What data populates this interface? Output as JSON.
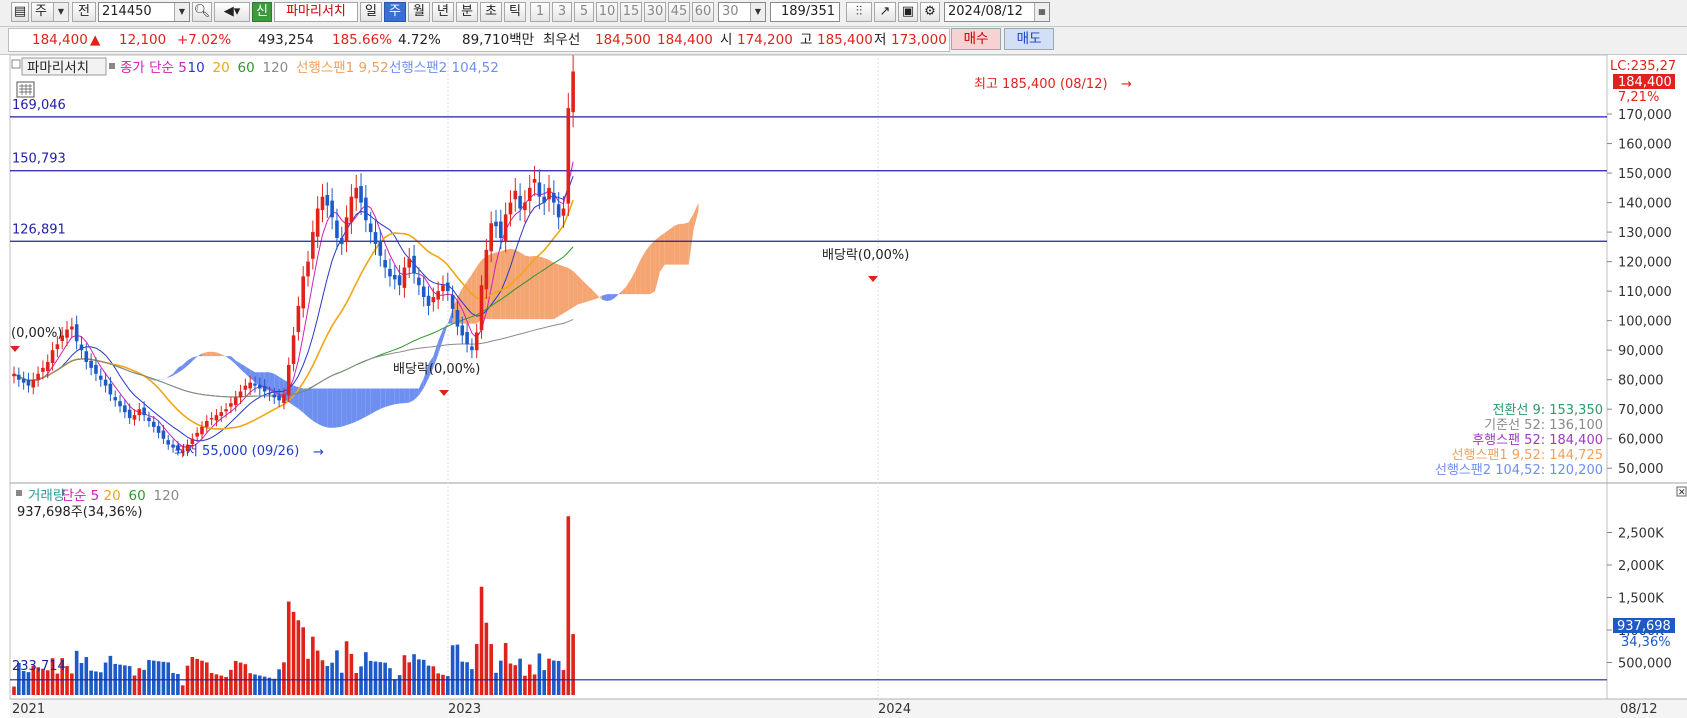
{
  "toolbar": {
    "period_label": "주",
    "prev_label": "전",
    "stock_code": "214450",
    "new_badge": "신",
    "stock_name": "파마리서치",
    "intervals": [
      "일",
      "주",
      "월",
      "년",
      "분",
      "초",
      "틱"
    ],
    "selected_interval": "주",
    "counts": [
      "1",
      "3",
      "5",
      "10",
      "15",
      "30",
      "45",
      "60"
    ],
    "count_value": "30",
    "range_value": "189/351",
    "date_value": "2024/08/12"
  },
  "quote": {
    "price": "184,400",
    "arrow": "▲",
    "change": "12,100",
    "change_pct": "+7.02%",
    "volume": "493,254",
    "volume_ratio": "185.66%",
    "turnover": "4.72%",
    "amount": "89,710백만",
    "best_label": "최우선",
    "ask": "184,500",
    "bid": "184,400",
    "open_label": "시",
    "open": "174,200",
    "high_label": "고",
    "high": "185,400",
    "low_label": "저",
    "low": "173,000",
    "buy_label": "매수",
    "sell_label": "매도"
  },
  "colors": {
    "up": "#e0221b",
    "down": "#1c5ac8",
    "ma5": "#d21fb8",
    "ma10": "#2838c8",
    "ma20": "#f2a516",
    "ma60": "#2c9a2c",
    "ma120": "#8a8a8a",
    "cloud_up": "#f5a572",
    "cloud_down": "#6f8ff0",
    "hline": "#1f1fa8"
  },
  "price_panel": {
    "title": "파마리서치",
    "legend": [
      {
        "text": "종가 단순 5",
        "color": "#d21fb8"
      },
      {
        "text": "10",
        "color": "#2838c8"
      },
      {
        "text": "20",
        "color": "#f2a516"
      },
      {
        "text": "60",
        "color": "#2c9a2c"
      },
      {
        "text": "120",
        "color": "#8a8a8a"
      },
      {
        "text": "선행스팬1 9,52",
        "color": "#f2a05a"
      },
      {
        "text": "선행스팬2 104,52",
        "color": "#6f8ff0"
      }
    ],
    "hlines": [
      {
        "label": "169,046",
        "value": 169046
      },
      {
        "label": "150,793",
        "value": 150793
      },
      {
        "label": "126,891",
        "value": 126891
      }
    ],
    "annotations": {
      "high": "최고 185,400 (08/12)",
      "low": "최저 55,000 (09/26)",
      "div1": "배당락(0,00%)",
      "div2": "배당락(0,00%)",
      "div0": "(0,00%)"
    },
    "right_labels": {
      "lc": "LC:235,27",
      "price_tag": "184,400",
      "pct": "7,21%"
    },
    "ichimoku_readout": [
      {
        "text": "전환선 9: 153,350",
        "color": "#2c9a6a"
      },
      {
        "text": "기준선 52: 136,100",
        "color": "#8a8a8a"
      },
      {
        "text": "후행스팬 52: 184,400",
        "color": "#a03ac8"
      },
      {
        "text": "선행스팬1 9,52: 144,725",
        "color": "#f2a05a"
      },
      {
        "text": "선행스팬2 104,52: 120,200",
        "color": "#6f8ff0"
      }
    ]
  },
  "volume_panel": {
    "legend": [
      {
        "text": "거래량",
        "color": "#2c9a9a"
      },
      {
        "text": "단순 5",
        "color": "#d21fb8"
      },
      {
        "text": "20",
        "color": "#f2a516"
      },
      {
        "text": "60",
        "color": "#2c9a2c"
      },
      {
        "text": "120",
        "color": "#8a8a8a"
      }
    ],
    "current": "937,698주(34,36%)",
    "hline_label": "233,714",
    "tag_value": "937,698",
    "tag_pct": "34,36%"
  },
  "x_axis": {
    "labels": [
      "2021",
      "2023",
      "2024"
    ],
    "end_label": "08/12"
  },
  "chart_data": [
    {
      "type": "candlestick",
      "title": "파마리서치",
      "interval": "weekly",
      "y_axis": {
        "min": 45000,
        "max": 190000,
        "ticks": [
          50000,
          60000,
          70000,
          80000,
          90000,
          100000,
          110000,
          120000,
          130000,
          140000,
          150000,
          160000,
          170000,
          180000
        ],
        "tick_labels": [
          "50,000",
          "60,000",
          "70,000",
          "80,000",
          "90,000",
          "100,000",
          "110,000",
          "120,000",
          "130,000",
          "140,000",
          "150,000",
          "160,000",
          "170,000"
        ]
      },
      "x_axis_labels": [
        "2021",
        "2023",
        "2024"
      ],
      "close_series_weekly": [
        82000,
        80000,
        79000,
        78000,
        80000,
        82000,
        84000,
        86000,
        90000,
        92000,
        95000,
        97000,
        98000,
        93000,
        90000,
        86000,
        84000,
        82000,
        80000,
        78000,
        75000,
        73000,
        71000,
        69000,
        67000,
        68000,
        70000,
        68000,
        66000,
        64000,
        62000,
        60000,
        58000,
        57000,
        56000,
        56000,
        58000,
        60000,
        62000,
        64000,
        66000,
        67000,
        68000,
        69000,
        70000,
        72000,
        74000,
        76000,
        78000,
        79000,
        78000,
        77000,
        76000,
        75000,
        74000,
        73000,
        75000,
        85000,
        95000,
        105000,
        115000,
        120000,
        130000,
        138000,
        142000,
        139000,
        135000,
        128000,
        126000,
        135000,
        142000,
        145000,
        140000,
        134000,
        130000,
        126000,
        122000,
        118000,
        115000,
        114000,
        112000,
        118000,
        121000,
        116000,
        112000,
        108000,
        105000,
        108000,
        110000,
        112000,
        110000,
        104000,
        98000,
        95000,
        92000,
        90000,
        96000,
        112000,
        124000,
        133000,
        132000,
        128000,
        136000,
        140000,
        144000,
        138000,
        140000,
        145000,
        148000,
        142000,
        140000,
        145000,
        140000,
        135000,
        138000,
        172000,
        184400
      ],
      "ichimoku": {
        "conversion_9": 153350,
        "base_52": 136100,
        "lagging_52": 184400,
        "leading_span1": 144725,
        "leading_span2": 120200
      },
      "horizontal_lines": [
        169046,
        150793,
        126891
      ],
      "high": {
        "value": 185400,
        "date": "08/12"
      },
      "low": {
        "value": 55000,
        "date": "09/26"
      }
    },
    {
      "type": "bar",
      "title": "거래량",
      "y_axis": {
        "ticks": [
          500000,
          1000000,
          1500000,
          2000000,
          2500000
        ],
        "tick_labels": [
          "500,000",
          "1,000K",
          "1,500K",
          "2,000K",
          "2,500K"
        ]
      },
      "latest_volume": 937698,
      "reference_line": 233714
    }
  ]
}
